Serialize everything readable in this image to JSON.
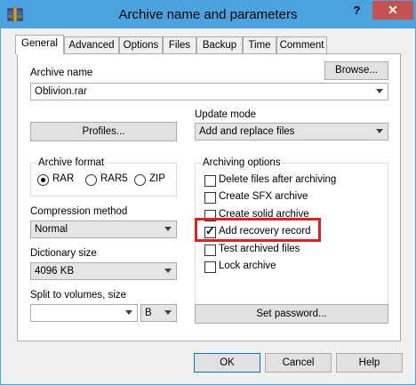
{
  "window": {
    "title": "Archive name and parameters",
    "help_button": "?",
    "close_button": "✕"
  },
  "tabs": [
    {
      "label": "General",
      "active": true
    },
    {
      "label": "Advanced"
    },
    {
      "label": "Options"
    },
    {
      "label": "Files"
    },
    {
      "label": "Backup"
    },
    {
      "label": "Time"
    },
    {
      "label": "Comment"
    }
  ],
  "archive_name": {
    "label": "Archive name",
    "browse_label": "Browse...",
    "value": "Oblivion.rar"
  },
  "profiles_label": "Profiles...",
  "update_mode": {
    "label": "Update mode",
    "selected": "Add and replace files"
  },
  "archive_format": {
    "label": "Archive format",
    "options": [
      {
        "label": "RAR",
        "selected": true
      },
      {
        "label": "RAR5",
        "selected": false
      },
      {
        "label": "ZIP",
        "selected": false
      }
    ]
  },
  "archiving_options": {
    "label": "Archiving options",
    "items": [
      {
        "label": "Delete files after archiving",
        "checked": false
      },
      {
        "label": "Create SFX archive",
        "checked": false
      },
      {
        "label": "Create solid archive",
        "checked": false
      },
      {
        "label": "Add recovery record",
        "checked": true,
        "highlighted": true
      },
      {
        "label": "Test archived files",
        "checked": false
      },
      {
        "label": "Lock archive",
        "checked": false
      }
    ]
  },
  "compression_method": {
    "label": "Compression method",
    "selected": "Normal"
  },
  "dictionary_size": {
    "label": "Dictionary size",
    "selected": "4096 KB"
  },
  "split_volumes": {
    "label": "Split to volumes, size",
    "value": "",
    "unit": "B"
  },
  "set_password_label": "Set password...",
  "footer": {
    "ok": "OK",
    "cancel": "Cancel",
    "help": "Help"
  },
  "colors": {
    "titlebar": "#4aa3df",
    "close": "#c75050",
    "highlight": "#e02020"
  }
}
